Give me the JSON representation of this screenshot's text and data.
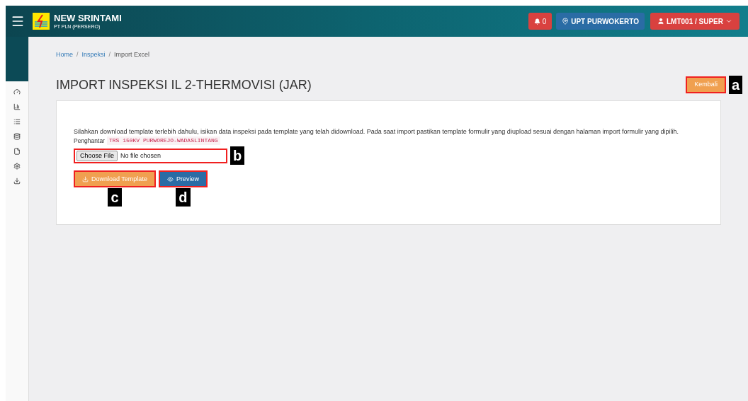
{
  "header": {
    "app_name": "NEW SRINTAMI",
    "company": "PT PLN (PERSERO)",
    "notifications": "0",
    "unit": "UPT PURWOKERTO",
    "user": "LMT001 / SUPER"
  },
  "sidebar": {
    "items": [
      {
        "kind": "gauge"
      },
      {
        "kind": "chart"
      },
      {
        "kind": "list"
      },
      {
        "kind": "database"
      },
      {
        "kind": "file"
      },
      {
        "kind": "settings"
      },
      {
        "kind": "download"
      }
    ]
  },
  "breadcrumb": [
    {
      "label": "Home",
      "link": true
    },
    {
      "separator": "/",
      "label": "Inspeksi",
      "link": true
    },
    {
      "separator": "/",
      "label": "Import Excel",
      "link": false
    }
  ],
  "page_title": "IMPORT INSPEKSI IL 2-THERMOVISI (JAR)",
  "back_button": {
    "label": "Kembali",
    "marker": "a"
  },
  "instructions": "Silahkan download template terlebih dahulu, isikan data inspeksi pada template yang telah didownload. Pada saat import pastikan template formulir yang diupload sesuai dengan halaman import formulir yang dipilih.",
  "penghantar": {
    "label": "Penghantar",
    "value": "TRS 150KV PURWOREJO-WADASLINTANG"
  },
  "file_input": {
    "button": "Choose File",
    "status": "No file chosen",
    "marker": "b"
  },
  "buttons": [
    {
      "kind": "download",
      "label": "Download Template",
      "marker": "c"
    },
    {
      "kind": "preview",
      "label": "Preview",
      "marker": "d"
    }
  ]
}
